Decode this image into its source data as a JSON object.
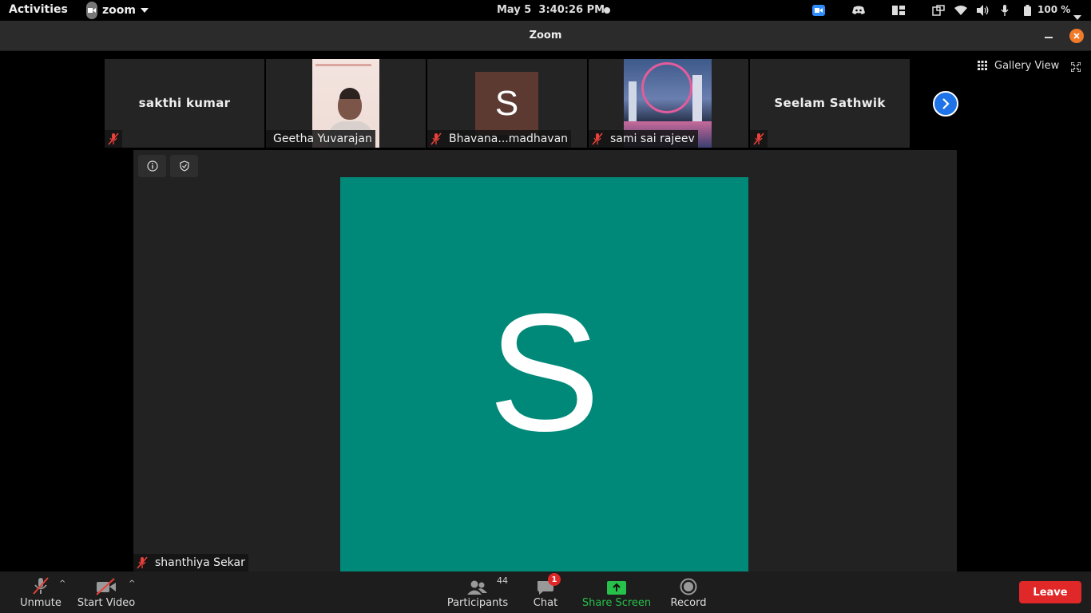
{
  "topbar": {
    "activities": "Activities",
    "app_name": "zoom",
    "date": "May 5",
    "time": "3:40:26 PM",
    "battery": "100 %"
  },
  "window": {
    "title": "Zoom"
  },
  "gallery": {
    "view_label": "Gallery View",
    "thumbnails": [
      {
        "name": "sakthi kumar"
      },
      {
        "name": "Geetha Yuvarajan"
      },
      {
        "name": "Bhavana...madhavan",
        "avatar_letter": "S"
      },
      {
        "name": "sami sai rajeev"
      },
      {
        "name": "Seelam Sathwik"
      }
    ]
  },
  "main": {
    "speaker_name": "shanthiya Sekar",
    "avatar_letter": "S",
    "avatar_color": "#008978"
  },
  "toolbar": {
    "unmute": "Unmute",
    "start_video": "Start Video",
    "participants": "Participants",
    "participants_count": "44",
    "chat": "Chat",
    "chat_badge": "1",
    "share_screen": "Share Screen",
    "record": "Record",
    "leave": "Leave"
  },
  "colors": {
    "accent_green": "#27c04a",
    "leave_red": "#e02828",
    "nav_blue": "#1f73e8"
  }
}
